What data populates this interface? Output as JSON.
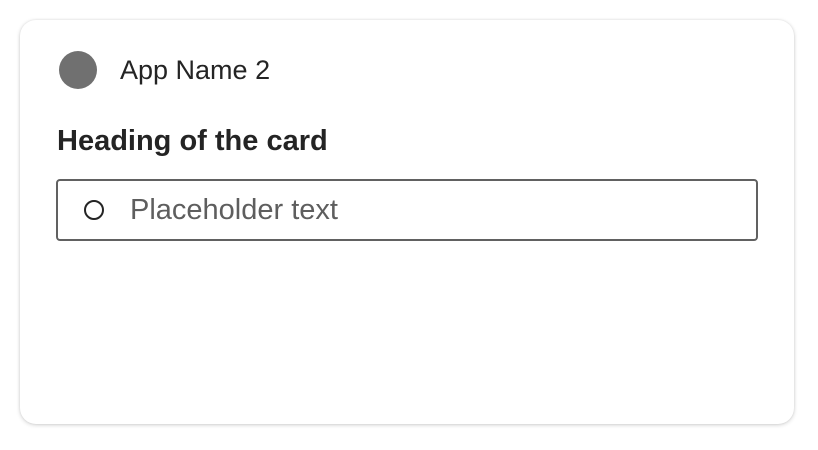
{
  "card": {
    "app_name": "App Name 2",
    "app_icon": "app-avatar-circle",
    "heading": "Heading of the card",
    "input": {
      "value": "",
      "placeholder": "Placeholder text",
      "icon": "radio-circle-icon"
    }
  },
  "colors": {
    "app_icon": "#707070",
    "text": "#242424",
    "input_border": "#616161",
    "placeholder": "#5e5e5e"
  }
}
